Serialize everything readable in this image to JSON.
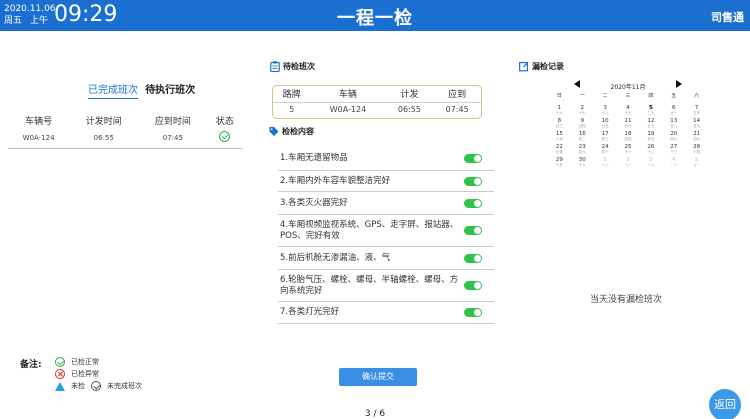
{
  "header": {
    "date": "2020.11.06",
    "weekday": "周五",
    "ampm": "上午",
    "time": "09:29",
    "title": "一程一检",
    "user": "司售通"
  },
  "left": {
    "tabs": [
      "已完成班次",
      "待执行班次"
    ],
    "active_tab": 0,
    "columns": [
      "车辆号",
      "计发时间",
      "应到时间",
      "状态"
    ],
    "rows": [
      {
        "vehicle": "W0A-124",
        "depart": "06:55",
        "arrive": "07:45",
        "status": "ok"
      }
    ]
  },
  "pending": {
    "title": "待检班次",
    "columns": [
      "路牌",
      "车辆",
      "计发",
      "应到"
    ],
    "row": [
      "5",
      "W0A-124",
      "06:55",
      "07:45"
    ]
  },
  "checklist": {
    "title": "检检内容",
    "items": [
      {
        "text": "1.车厢无遗留物品",
        "on": true
      },
      {
        "text": "2.车厢内外车容车貌整洁完好",
        "on": true
      },
      {
        "text": "3.各类灭火器完好",
        "on": true
      },
      {
        "text": "4.车厢视频监视系统、GPS、走字屏、报站器、POS、完好有效",
        "on": true
      },
      {
        "text": "5.前后机舱无渗漏油、液、气",
        "on": true
      },
      {
        "text": "6.轮胎气压、螺栓、螺母、半轴螺栓、螺母、方向系统完好",
        "on": true
      },
      {
        "text": "7.各类灯光完好",
        "on": true
      }
    ],
    "submit_label": "确认提交"
  },
  "calendar": {
    "title": "漏检记录",
    "month_label": "2020年11月",
    "weekdays": [
      "日",
      "一",
      "二",
      "三",
      "四",
      "五",
      "六"
    ],
    "weeks": [
      [
        [
          "1",
          "十六",
          ""
        ],
        [
          "2",
          "十七",
          ""
        ],
        [
          "3",
          "十八",
          ""
        ],
        [
          "4",
          "十九",
          ""
        ],
        [
          "5",
          "二十",
          "bold"
        ],
        [
          "6",
          "廿一",
          ""
        ],
        [
          "7",
          "立冬",
          ""
        ]
      ],
      [
        [
          "8",
          "廿三",
          ""
        ],
        [
          "9",
          "廿四",
          ""
        ],
        [
          "10",
          "廿五",
          ""
        ],
        [
          "11",
          "廿六",
          ""
        ],
        [
          "12",
          "廿七",
          ""
        ],
        [
          "13",
          "廿八",
          ""
        ],
        [
          "14",
          "廿九",
          ""
        ]
      ],
      [
        [
          "15",
          "十月",
          ""
        ],
        [
          "16",
          "初二",
          ""
        ],
        [
          "17",
          "初三",
          ""
        ],
        [
          "18",
          "初四",
          ""
        ],
        [
          "19",
          "初五",
          ""
        ],
        [
          "20",
          "初六",
          ""
        ],
        [
          "21",
          "初七",
          ""
        ]
      ],
      [
        [
          "22",
          "小雪",
          ""
        ],
        [
          "23",
          "初九",
          ""
        ],
        [
          "24",
          "初十",
          ""
        ],
        [
          "25",
          "十一",
          ""
        ],
        [
          "26",
          "十二",
          ""
        ],
        [
          "27",
          "十三",
          ""
        ],
        [
          "28",
          "十四",
          ""
        ]
      ],
      [
        [
          "29",
          "十五",
          ""
        ],
        [
          "30",
          "十六",
          ""
        ],
        [
          "1",
          "十七",
          "muted"
        ],
        [
          "2",
          "十八",
          "muted"
        ],
        [
          "3",
          "十九",
          "muted"
        ],
        [
          "4",
          "二十",
          "muted"
        ],
        [
          "5",
          "廿一",
          "muted"
        ]
      ]
    ],
    "empty_text": "当天没有漏检班次"
  },
  "legend": {
    "label": "备注:",
    "ok": "已检正常",
    "err": "已检异常",
    "unchecked": "未检",
    "incomplete": "未完成班次"
  },
  "pager": "3 / 6",
  "back_label": "返回",
  "colors": {
    "header": "#1a6fd1",
    "toggle_on": "#2fc34a",
    "button": "#3a8ee6"
  }
}
